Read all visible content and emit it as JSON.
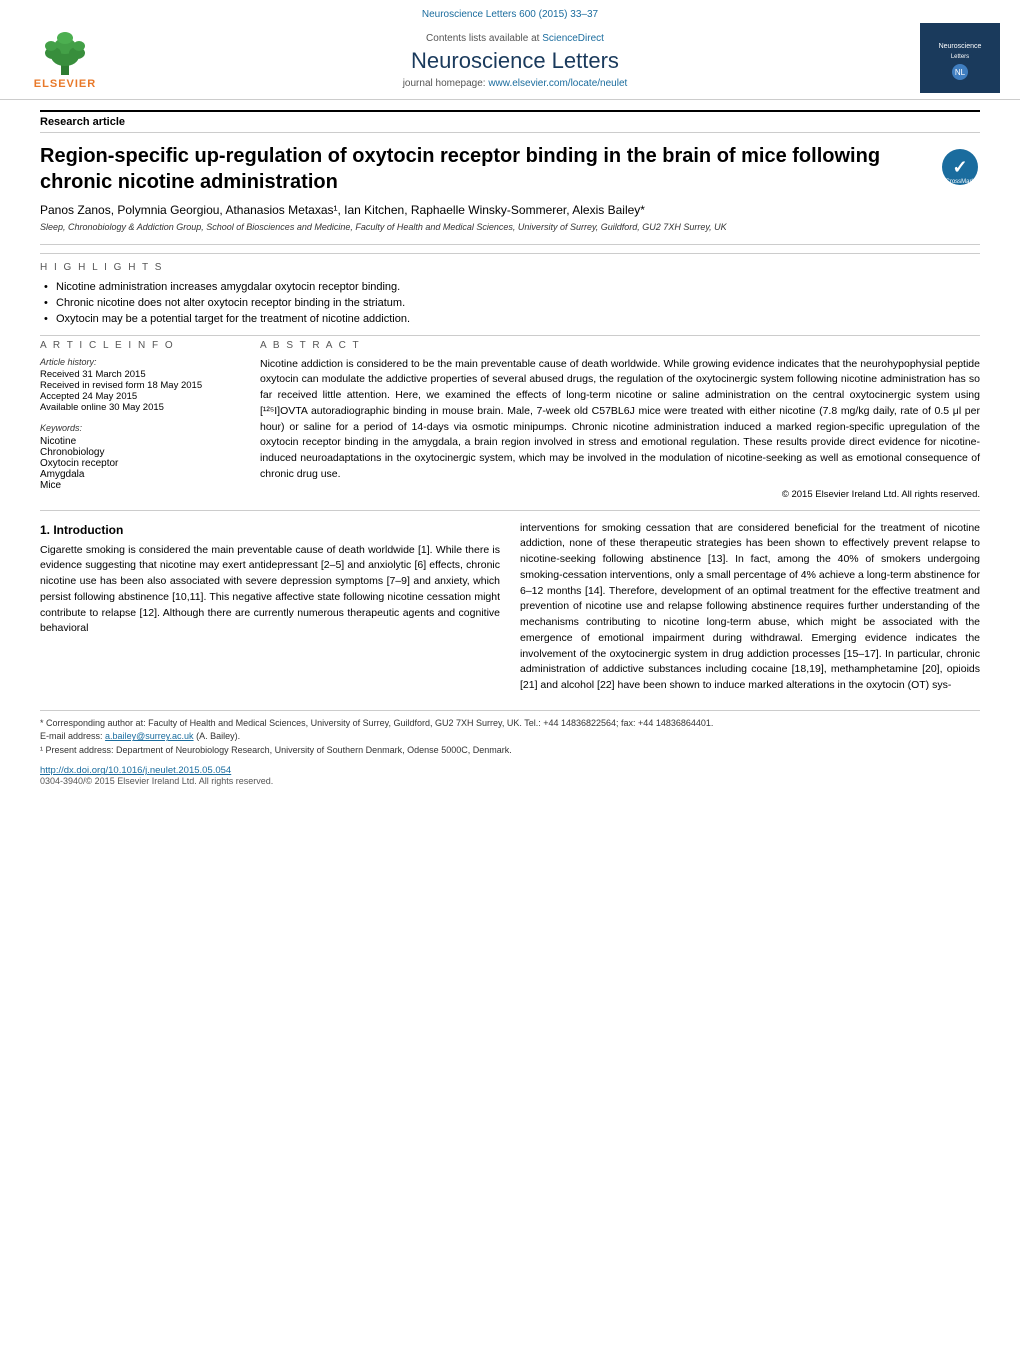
{
  "citation": "Neuroscience Letters 600 (2015) 33–37",
  "journal": {
    "contents_text": "Contents lists available at",
    "contents_link": "ScienceDirect",
    "title": "Neuroscience Letters",
    "homepage_text": "journal homepage:",
    "homepage_link": "www.elsevier.com/locate/neulet"
  },
  "article_type": "Research article",
  "article_title": "Region-specific up-regulation of oxytocin receptor binding in the brain of mice following chronic nicotine administration",
  "authors": "Panos Zanos, Polymnia Georgiou, Athanasios Metaxas¹, Ian Kitchen, Raphaelle Winsky-Sommerer, Alexis Bailey*",
  "affiliation": "Sleep, Chronobiology & Addiction Group, School of Biosciences and Medicine, Faculty of Health and Medical Sciences, University of Surrey, Guildford, GU2 7XH Surrey, UK",
  "highlights_label": "H I G H L I G H T S",
  "highlights": [
    "Nicotine administration increases amygdalar oxytocin receptor binding.",
    "Chronic nicotine does not alter oxytocin receptor binding in the striatum.",
    "Oxytocin may be a potential target for the treatment of nicotine addiction."
  ],
  "article_info_label": "A R T I C L E   I N F O",
  "article_history_label": "Article history:",
  "dates": [
    "Received 31 March 2015",
    "Received in revised form 18 May 2015",
    "Accepted 24 May 2015",
    "Available online 30 May 2015"
  ],
  "keywords_label": "Keywords:",
  "keywords": [
    "Nicotine",
    "Chronobiology",
    "Oxytocin receptor",
    "Amygdala",
    "Mice"
  ],
  "abstract_label": "A B S T R A C T",
  "abstract_text": "Nicotine addiction is considered to be the main preventable cause of death worldwide. While growing evidence indicates that the neurohypophysial peptide oxytocin can modulate the addictive properties of several abused drugs, the regulation of the oxytocinergic system following nicotine administration has so far received little attention. Here, we examined the effects of long-term nicotine or saline administration on the central oxytocinergic system using [¹²⁵I]OVTA autoradiographic binding in mouse brain. Male, 7-week old C57BL6J mice were treated with either nicotine (7.8 mg/kg daily, rate of 0.5 μl per hour) or saline for a period of 14-days via osmotic minipumps. Chronic nicotine administration induced a marked region-specific upregulation of the oxytocin receptor binding in the amygdala, a brain region involved in stress and emotional regulation. These results provide direct evidence for nicotine-induced neuroadaptations in the oxytocinergic system, which may be involved in the modulation of nicotine-seeking as well as emotional consequence of chronic drug use.",
  "copyright": "© 2015 Elsevier Ireland Ltd. All rights reserved.",
  "intro_heading": "1.  Introduction",
  "intro_col1": "Cigarette smoking is considered the main preventable cause of death worldwide [1]. While there is evidence suggesting that nicotine may exert antidepressant [2–5] and anxiolytic [6] effects, chronic nicotine use has been also associated with severe depression symptoms [7–9] and anxiety, which persist following abstinence [10,11]. This negative affective state following nicotine cessation might contribute to relapse [12]. Although there are currently numerous therapeutic agents and cognitive behavioral",
  "intro_col2": "interventions for smoking cessation that are considered beneficial for the treatment of nicotine addiction, none of these therapeutic strategies has been shown to effectively prevent relapse to nicotine-seeking following abstinence [13]. In fact, among the 40% of smokers undergoing smoking-cessation interventions, only a small percentage of 4% achieve a long-term abstinence for 6–12 months [14]. Therefore, development of an optimal treatment for the effective treatment and prevention of nicotine use and relapse following abstinence requires further understanding of the mechanisms contributing to nicotine long-term abuse, which might be associated with the emergence of emotional impairment during withdrawal.\n\nEmerging evidence indicates the involvement of the oxytocinergic system in drug addiction processes [15–17]. In particular, chronic administration of addictive substances including cocaine [18,19], methamphetamine [20], opioids [21] and alcohol [22] have been shown to induce marked alterations in the oxytocin (OT) sys-",
  "footnote_star": "* Corresponding author at: Faculty of Health and Medical Sciences, University of Surrey, Guildford, GU2 7XH Surrey, UK. Tel.: +44 14836822564; fax: +44 14836864401.",
  "footnote_email_prefix": "E-mail address:",
  "footnote_email": "a.bailey@surrey.ac.uk",
  "footnote_email_suffix": "(A. Bailey).",
  "footnote_1": "¹ Present address: Department of Neurobiology Research, University of Southern Denmark, Odense 5000C, Denmark.",
  "doi": "http://dx.doi.org/10.1016/j.neulet.2015.05.054",
  "issn": "0304-3940/© 2015 Elsevier Ireland Ltd. All rights reserved.",
  "months_detection": "months"
}
